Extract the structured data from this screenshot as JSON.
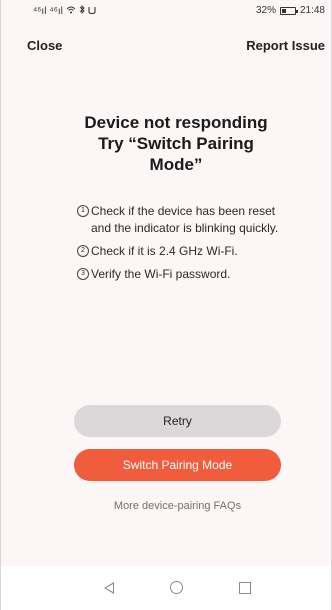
{
  "status_bar": {
    "signal_left": "⁴⁶ıl",
    "signal_right": "⁴⁶ıl",
    "wifi_icon": "wifi-icon",
    "bluetooth_icon": "bluetooth-icon",
    "extra_icon": "nfc-icon",
    "battery_percent": "32%",
    "time": "21:48"
  },
  "header": {
    "close_label": "Close",
    "report_label": "Report Issue"
  },
  "main": {
    "title_line1": "Device not responding",
    "title_line2": "Try “Switch Pairing",
    "title_line3": "Mode”",
    "steps": [
      {
        "num": "1",
        "text": "Check if the device has been reset and the indicator is blinking quickly."
      },
      {
        "num": "2",
        "text": "Check if it is 2.4 GHz Wi-Fi."
      },
      {
        "num": "3",
        "text": "Verify the Wi-Fi password."
      }
    ]
  },
  "actions": {
    "retry_label": "Retry",
    "switch_label": "Switch Pairing Mode",
    "faq_label": "More device-pairing FAQs"
  },
  "colors": {
    "accent": "#f05c3c",
    "retry_bg": "#dcd7d9",
    "page_bg": "#fdf6f6"
  }
}
